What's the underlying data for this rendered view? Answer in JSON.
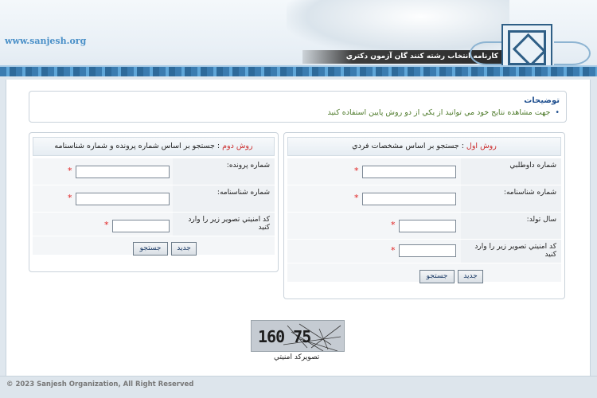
{
  "header": {
    "site_url": "www.sanjesh.org",
    "title": "کارنامه انتخاب رشته کنند گان آزمون دکتري"
  },
  "info": {
    "title": "توضيحات",
    "text": "جهت مشاهده نتايج خود مي توانيد از يکي از دو روش پايين استفاده کنيد"
  },
  "method1": {
    "method_label": "روش اول",
    "heading": " : جستجو بر اساس مشخصات فردي",
    "fields": [
      {
        "label": "شماره داوطلبي"
      },
      {
        "label": "شماره شناسنامه:"
      },
      {
        "label": "سال تولد:"
      },
      {
        "label": "کد امنيتي تصوير زير را وارد کنيد"
      }
    ],
    "search_button": "جستجو",
    "new_button": "جديد"
  },
  "method2": {
    "method_label": "روش دوم",
    "heading": " : جستجو بر اساس شماره پرونده و شماره شناسنامه",
    "fields": [
      {
        "label": "شماره پرونده:"
      },
      {
        "label": "شماره شناسنامه:"
      },
      {
        "label": "کد امنيتي تصوير زير را وارد کنيد"
      }
    ],
    "search_button": "جستجو",
    "new_button": "جديد"
  },
  "captcha": {
    "digits": "160 75",
    "caption": "تصويرکد امنيتي"
  },
  "footer": {
    "copyright": "© 2023 Sanjesh Organization, All Right Reserved"
  },
  "colors": {
    "accent_blue": "#1f4f8f",
    "required_red": "#e02020",
    "method_red": "#cc2a2a",
    "info_green": "#4d7a2a"
  }
}
